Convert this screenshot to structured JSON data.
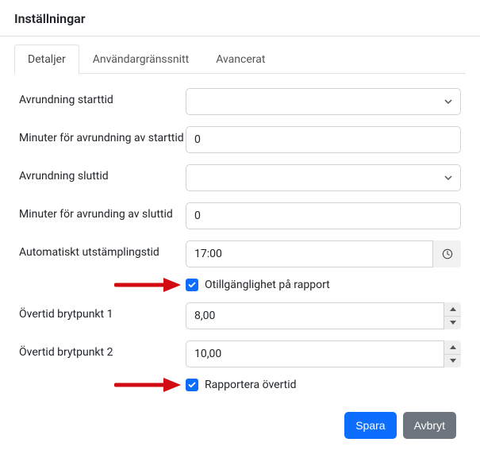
{
  "title": "Inställningar",
  "tabs": {
    "details": "Detaljer",
    "ui": "Användargränssnitt",
    "advanced": "Avancerat"
  },
  "fields": {
    "round_start_label": "Avrundning starttid",
    "round_start_value": "",
    "round_start_minutes_label": "Minuter för avrundning av starttid",
    "round_start_minutes_value": "0",
    "round_end_label": "Avrundning sluttid",
    "round_end_value": "",
    "round_end_minutes_label": "Minuter för avrunding av sluttid",
    "round_end_minutes_value": "0",
    "auto_stamp_label": "Automatiskt utstämplingstid",
    "auto_stamp_value": "17:00",
    "unavail_label": "Otillgänglighet på rapport",
    "ot1_label": "Övertid brytpunkt 1",
    "ot1_value": "8,00",
    "ot2_label": "Övertid brytpunkt 2",
    "ot2_value": "10,00",
    "report_ot_label": "Rapportera övertid"
  },
  "buttons": {
    "save": "Spara",
    "cancel": "Avbryt"
  },
  "colors": {
    "primary": "#0d6efd",
    "secondary": "#6c757d",
    "arrow": "#d20a11"
  }
}
